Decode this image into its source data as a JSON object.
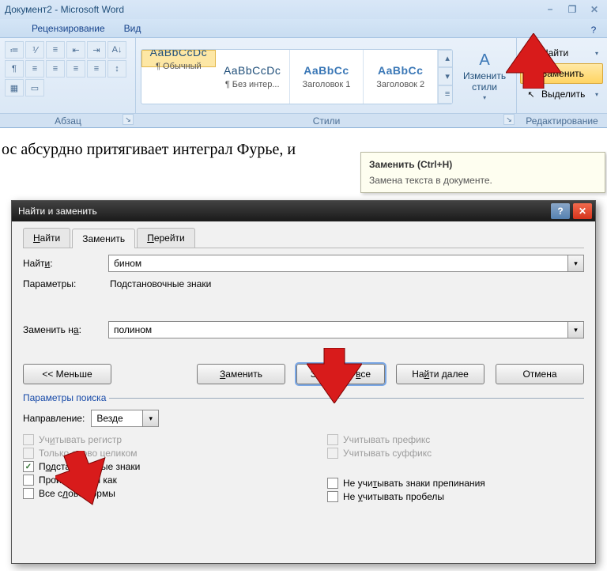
{
  "window": {
    "title": "Документ2 - Microsoft Word"
  },
  "ribbon": {
    "tabs": [
      "Рецензирование",
      "Вид"
    ],
    "groups": {
      "paragraph": "Абзац",
      "styles": "Стили",
      "editing": "Редактирование"
    },
    "styles": [
      {
        "sample": "AaBbCcDc",
        "name": "¶ Обычный"
      },
      {
        "sample": "AaBbCcDc",
        "name": "¶ Без интер..."
      },
      {
        "sample": "AaBbCc",
        "name": "Заголовок 1"
      },
      {
        "sample": "AaBbCc",
        "name": "Заголовок 2"
      }
    ],
    "change_styles": "Изменить стили",
    "editing_items": {
      "find": "Найти",
      "replace": "Заменить",
      "select": "Выделить"
    }
  },
  "tooltip": {
    "title": "Заменить (Ctrl+H)",
    "desc": "Замена текста в документе."
  },
  "document": {
    "line1": "ос абсурдно притягивает интеграл Фурье, и"
  },
  "dialog": {
    "title": "Найти и заменить",
    "tabs": {
      "find": "Найти",
      "replace": "Заменить",
      "goto": "Перейти"
    },
    "find_label": "Найти:",
    "find_value": "бином",
    "params_label": "Параметры:",
    "params_value": "Подстановочные знаки",
    "replace_label": "Заменить на:",
    "replace_value": "полином",
    "buttons": {
      "less": "<< Меньше",
      "replace": "Заменить",
      "replace_all": "Заменить все",
      "find_next": "Найти далее",
      "cancel": "Отмена"
    },
    "search_options": "Параметры поиска",
    "direction_label": "Направление:",
    "direction_value": "Везде",
    "checks": {
      "match_case": "Учитывать регистр",
      "whole_word": "Только слово целиком",
      "wildcards": "Подстановочные знаки",
      "sounds_like": "Произносится как",
      "word_forms": "Все словоформы",
      "prefix": "Учитывать префикс",
      "suffix": "Учитывать суффикс",
      "ignore_punct": "Не учитывать знаки препинания",
      "ignore_space": "Не учитывать пробелы"
    }
  }
}
